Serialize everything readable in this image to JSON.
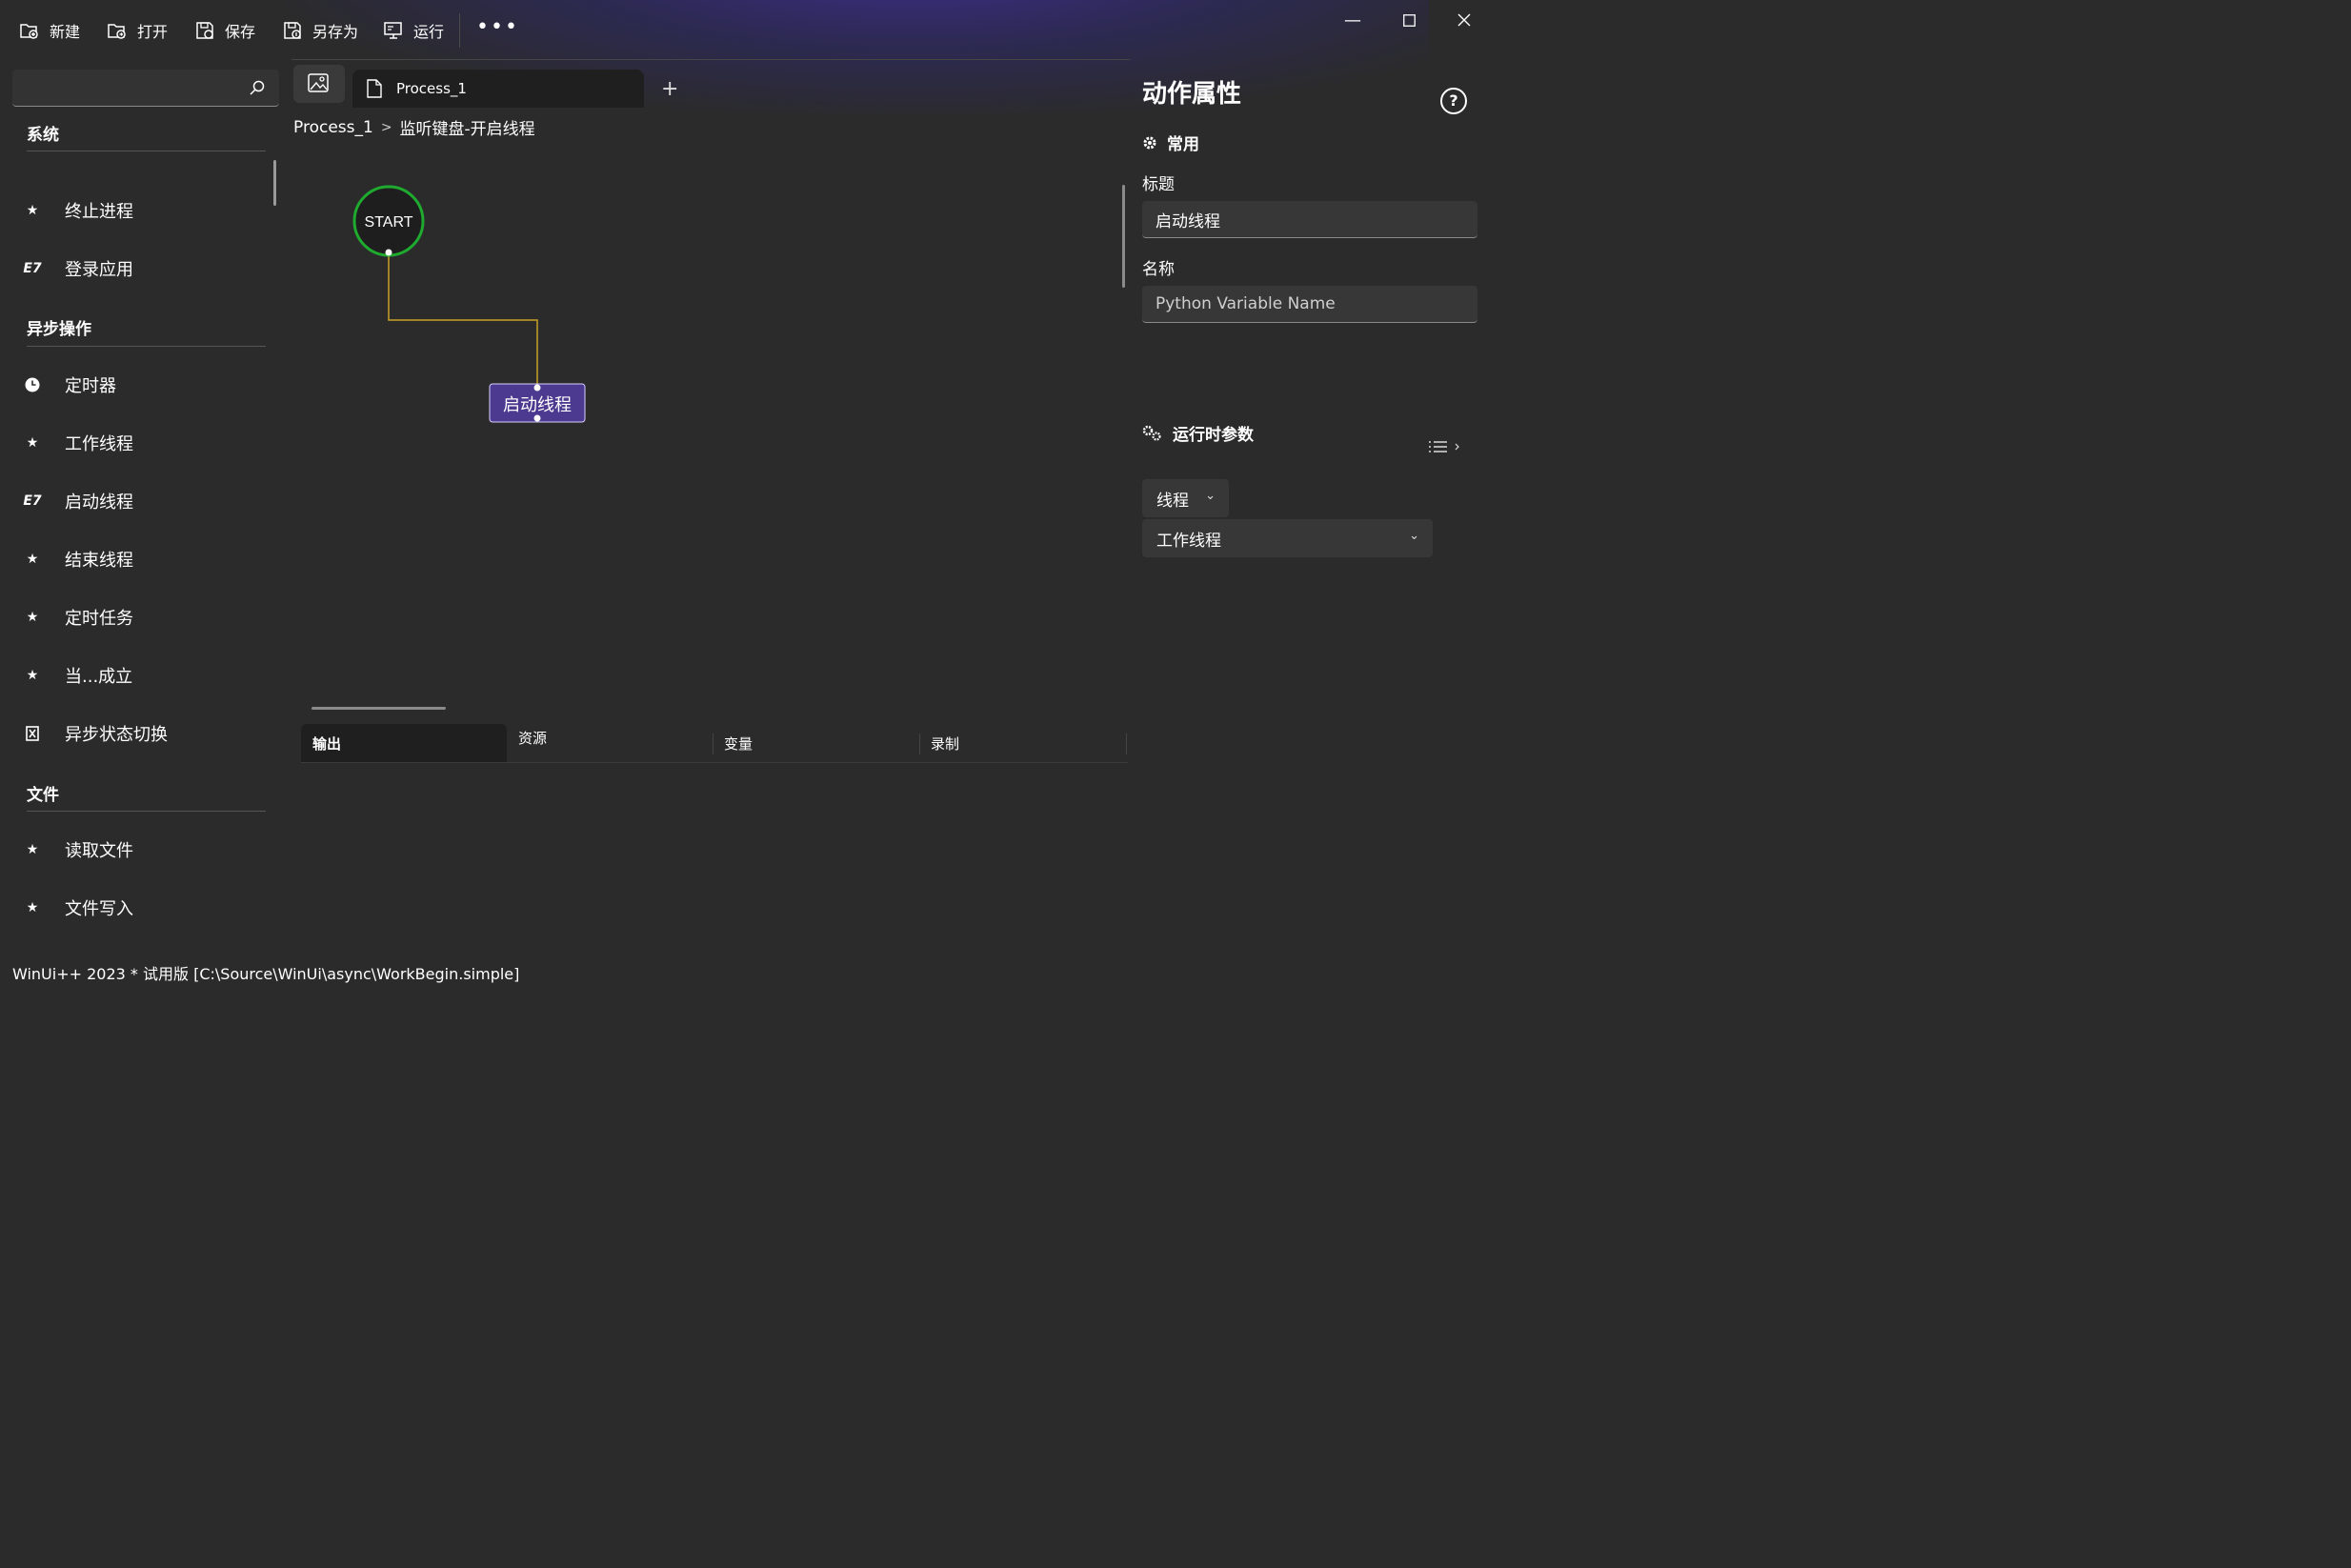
{
  "toolbar": {
    "new_label": "新建",
    "open_label": "打开",
    "save_label": "保存",
    "saveas_label": "另存为",
    "run_label": "运行",
    "more_label": "•••"
  },
  "search": {
    "placeholder": ""
  },
  "sidebar": {
    "categories": [
      {
        "label": "系统",
        "items": [
          {
            "label": "终止进程",
            "icon": "star-icon"
          },
          {
            "label": "登录应用",
            "icon": "e7-icon"
          }
        ]
      },
      {
        "label": "异步操作",
        "items": [
          {
            "label": "定时器",
            "icon": "clock-icon"
          },
          {
            "label": "工作线程",
            "icon": "star-icon"
          },
          {
            "label": "启动线程",
            "icon": "e7-icon"
          },
          {
            "label": "结束线程",
            "icon": "star-icon"
          },
          {
            "label": "定时任务",
            "icon": "star-icon"
          },
          {
            "label": "当...成立",
            "icon": "star-icon"
          },
          {
            "label": "异步状态切换",
            "icon": "toggle-icon"
          }
        ]
      },
      {
        "label": "文件",
        "items": [
          {
            "label": "读取文件",
            "icon": "star-icon"
          },
          {
            "label": "文件写入",
            "icon": "star-icon"
          }
        ]
      }
    ]
  },
  "tabs": {
    "doc_label": "Process_1",
    "add_label": "+"
  },
  "breadcrumb": {
    "root": "Process_1",
    "separator": ">",
    "current": "监听键盘-开启线程"
  },
  "flow": {
    "start_label": "START",
    "node_label": "启动线程",
    "connector_color": "#c9a227",
    "start_border_color": "#1faa2f",
    "node_color": "#4b3a8f"
  },
  "bottom_tabs": [
    "输出",
    "资源",
    "变量",
    "录制"
  ],
  "properties": {
    "title": "动作属性",
    "help_label": "?",
    "common_label": "常用",
    "title_field_label": "标题",
    "title_value": "启动线程",
    "name_field_label": "名称",
    "name_placeholder": "Python Variable Name",
    "runtime_label": "运行时参数",
    "thread_dropdown": "线程",
    "worker_dropdown": "工作线程"
  },
  "status_text": "WinUi++ 2023 * 试用版 [C:\\Source\\WinUi\\async\\WorkBegin.simple]",
  "colors": {
    "background": "#2b2b2b",
    "accent_glow": "#3e2e96",
    "panel": "#373737"
  }
}
